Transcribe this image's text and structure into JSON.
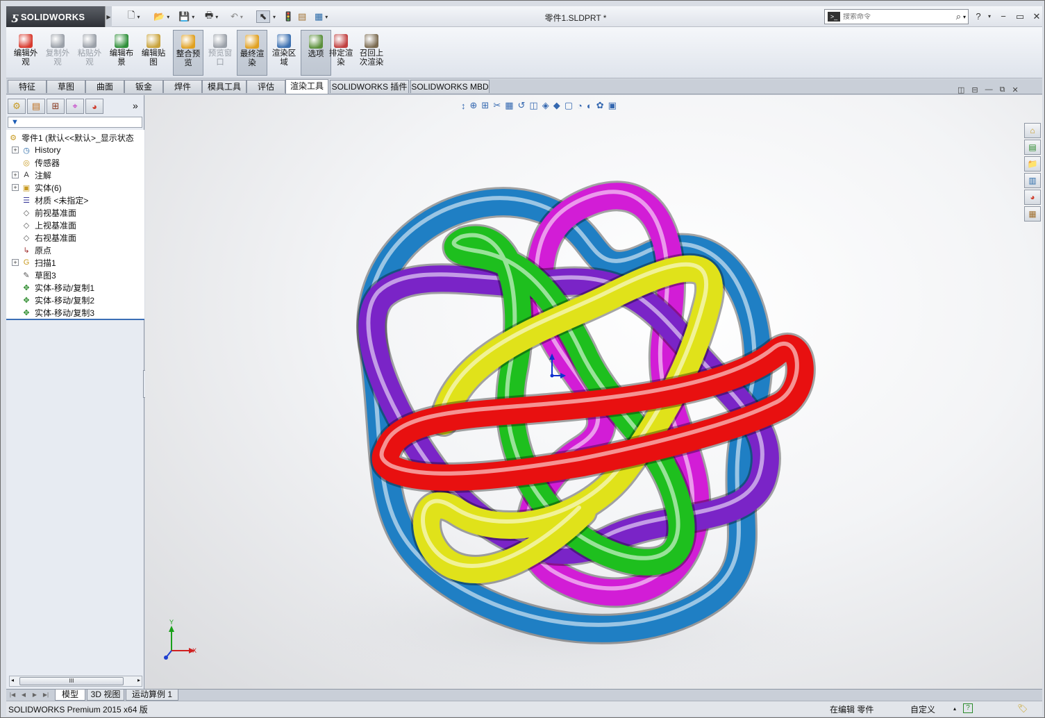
{
  "app": {
    "logo_ds": "ƽ",
    "logo_text": "SOLIDWORKS",
    "document_title": "零件1.SLDPRT *"
  },
  "quick_access": {
    "icons": [
      "new-document-icon",
      "open-icon",
      "save-icon",
      "print-icon",
      "undo-icon",
      "select-icon",
      "rebuild-icon",
      "file-properties-icon",
      "options-icon"
    ]
  },
  "search": {
    "placeholder": "搜索命令",
    "prompt_glyph": ">_"
  },
  "window_controls": {
    "help": "?",
    "minimize": "−",
    "restore": "▭",
    "close": "✕"
  },
  "ribbon": {
    "buttons": [
      {
        "label": "编辑外\n观",
        "state": "normal",
        "color": "#d83a2e"
      },
      {
        "label": "复制外\n观",
        "state": "disabled",
        "color": "#9aa0a8"
      },
      {
        "label": "粘贴外\n观",
        "state": "disabled",
        "color": "#9aa0a8"
      },
      {
        "label": "编辑布\n景",
        "state": "normal",
        "color": "#2f8f3a"
      },
      {
        "label": "编辑贴\n图",
        "state": "normal",
        "color": "#c8a23a"
      },
      {
        "label": "整合预\n览",
        "state": "pressed",
        "color": "#e0a020"
      },
      {
        "label": "预览窗\n口",
        "state": "disabled",
        "color": "#9aa0a8"
      },
      {
        "label": "最终渲\n染",
        "state": "pressed",
        "color": "#e0a020"
      },
      {
        "label": "渲染区\n域",
        "state": "normal",
        "color": "#3a6fb0"
      },
      {
        "label": "选项",
        "state": "pressed",
        "color": "#5a8f3a"
      },
      {
        "label": "排定渲\n染",
        "state": "normal",
        "color": "#c04040"
      },
      {
        "label": "召回上\n次渲染",
        "state": "normal",
        "color": "#7a6a50"
      }
    ]
  },
  "tabs": [
    "特征",
    "草图",
    "曲面",
    "钣金",
    "焊件",
    "模具工具",
    "评估",
    "渲染工具",
    "SOLIDWORKS 插件",
    "SOLIDWORKS MBD"
  ],
  "active_tab": "渲染工具",
  "panel": {
    "tab_icons": [
      "featuremanager-icon",
      "propertymanager-icon",
      "configurationmanager-icon",
      "dimxpert-icon",
      "displaymanager-icon"
    ],
    "expand_glyph": "»",
    "filter_glyph": "▼",
    "tree": [
      {
        "label": "零件1 (默认<<默认>_显示状态",
        "expander": false,
        "indent": 0,
        "icon": "part-icon",
        "glyph": "⚙"
      },
      {
        "label": "History",
        "expander": true,
        "indent": 1,
        "icon": "history-icon",
        "glyph": "◷"
      },
      {
        "label": "传感器",
        "expander": false,
        "indent": 1,
        "icon": "sensor-icon",
        "glyph": "◎"
      },
      {
        "label": "注解",
        "expander": true,
        "indent": 1,
        "icon": "annotation-icon",
        "glyph": "A"
      },
      {
        "label": "实体(6)",
        "expander": true,
        "indent": 1,
        "icon": "solid-body-icon",
        "glyph": "▣"
      },
      {
        "label": "材质 <未指定>",
        "expander": false,
        "indent": 1,
        "icon": "material-icon",
        "glyph": "☰"
      },
      {
        "label": "前视基准面",
        "expander": false,
        "indent": 1,
        "icon": "plane-icon",
        "glyph": "◇"
      },
      {
        "label": "上视基准面",
        "expander": false,
        "indent": 1,
        "icon": "plane-icon",
        "glyph": "◇"
      },
      {
        "label": "右视基准面",
        "expander": false,
        "indent": 1,
        "icon": "plane-icon",
        "glyph": "◇"
      },
      {
        "label": "原点",
        "expander": false,
        "indent": 1,
        "icon": "origin-icon",
        "glyph": "↳"
      },
      {
        "label": "扫描1",
        "expander": true,
        "indent": 1,
        "icon": "sweep-icon",
        "glyph": "G"
      },
      {
        "label": "草图3",
        "expander": false,
        "indent": 1,
        "icon": "sketch-icon",
        "glyph": "✎"
      },
      {
        "label": "实体-移动/复制1",
        "expander": false,
        "indent": 1,
        "icon": "move-copy-icon",
        "glyph": "✥"
      },
      {
        "label": "实体-移动/复制2",
        "expander": false,
        "indent": 1,
        "icon": "move-copy-icon",
        "glyph": "✥"
      },
      {
        "label": "实体-移动/复制3",
        "expander": false,
        "indent": 1,
        "icon": "move-copy-icon",
        "glyph": "✥"
      }
    ],
    "scroll_thumb": "III",
    "collapse_glyph": "⋮"
  },
  "viewport": {
    "heads_up_toolbar": [
      "↕",
      "⊕",
      "⊞",
      "✂",
      "▦",
      "↺",
      "◫",
      "◈",
      "◆",
      "▢",
      "◔",
      "◐",
      "✿",
      "▣"
    ],
    "controls": [
      "◫",
      "⊟",
      "—",
      "⧉",
      "✕"
    ],
    "axis_labels": {
      "x": "X",
      "y": "Y"
    },
    "knot_colors": [
      "#1f7fc4",
      "#d21dd6",
      "#7a24c7",
      "#1ebf1e",
      "#e0e21a",
      "#e81010"
    ]
  },
  "task_pane": [
    "home-icon",
    "resources-icon",
    "design-library-icon",
    "file-explorer-icon",
    "appearances-icon",
    "custom-properties-icon"
  ],
  "task_pane_glyphs": [
    "⌂",
    "▤",
    "📁",
    "▥",
    "◕",
    "▦"
  ],
  "bottom_tabs": [
    "模型",
    "3D 视图",
    "运动算例 1"
  ],
  "active_bottom_tab": "模型",
  "nav_arrows": [
    "|◀",
    "◀",
    "▶",
    "▶|"
  ],
  "status": {
    "product": "SOLIDWORKS Premium 2015 x64 版",
    "mode": "在编辑 零件",
    "units": "自定义",
    "help_glyph": "?",
    "tag_glyph": "🏷"
  }
}
